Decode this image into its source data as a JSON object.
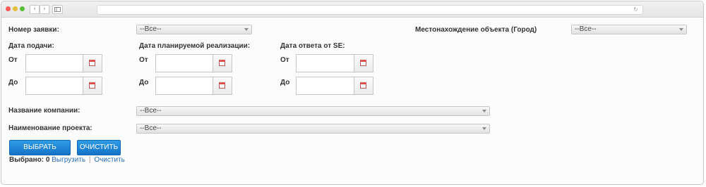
{
  "browser": {
    "back_glyph": "‹",
    "forward_glyph": "›",
    "reload_glyph": "↻"
  },
  "filters": {
    "request_number": {
      "label": "Номер заявки:",
      "value": "--Все--"
    },
    "location": {
      "label": "Местонахождение объекта (Город)",
      "value": "--Все--"
    },
    "submission_date": {
      "label": "Дата подачи:",
      "from_label": "От",
      "to_label": "До",
      "from_value": "",
      "to_value": ""
    },
    "planned_date": {
      "label": "Дата планируемой реализации:",
      "from_label": "От",
      "to_label": "До",
      "from_value": "",
      "to_value": ""
    },
    "se_response_date": {
      "label": "Дата ответа от SE:",
      "from_label": "От",
      "to_label": "До",
      "from_value": "",
      "to_value": ""
    },
    "company_name": {
      "label": "Название компании:",
      "value": "--Все--"
    },
    "project_name": {
      "label": "Наименование проекта:",
      "value": "--Все--"
    }
  },
  "actions": {
    "select_label": "ВЫБРАТЬ",
    "clear_label": "ОЧИСТИТЬ"
  },
  "summary": {
    "selected_label": "Выбрано:",
    "selected_count": "0",
    "export_link": "Выгрузить",
    "separator": "|",
    "clear_link": "Очистить"
  },
  "icons": [
    "calendar-icon",
    "dropdown-arrow-icon"
  ]
}
